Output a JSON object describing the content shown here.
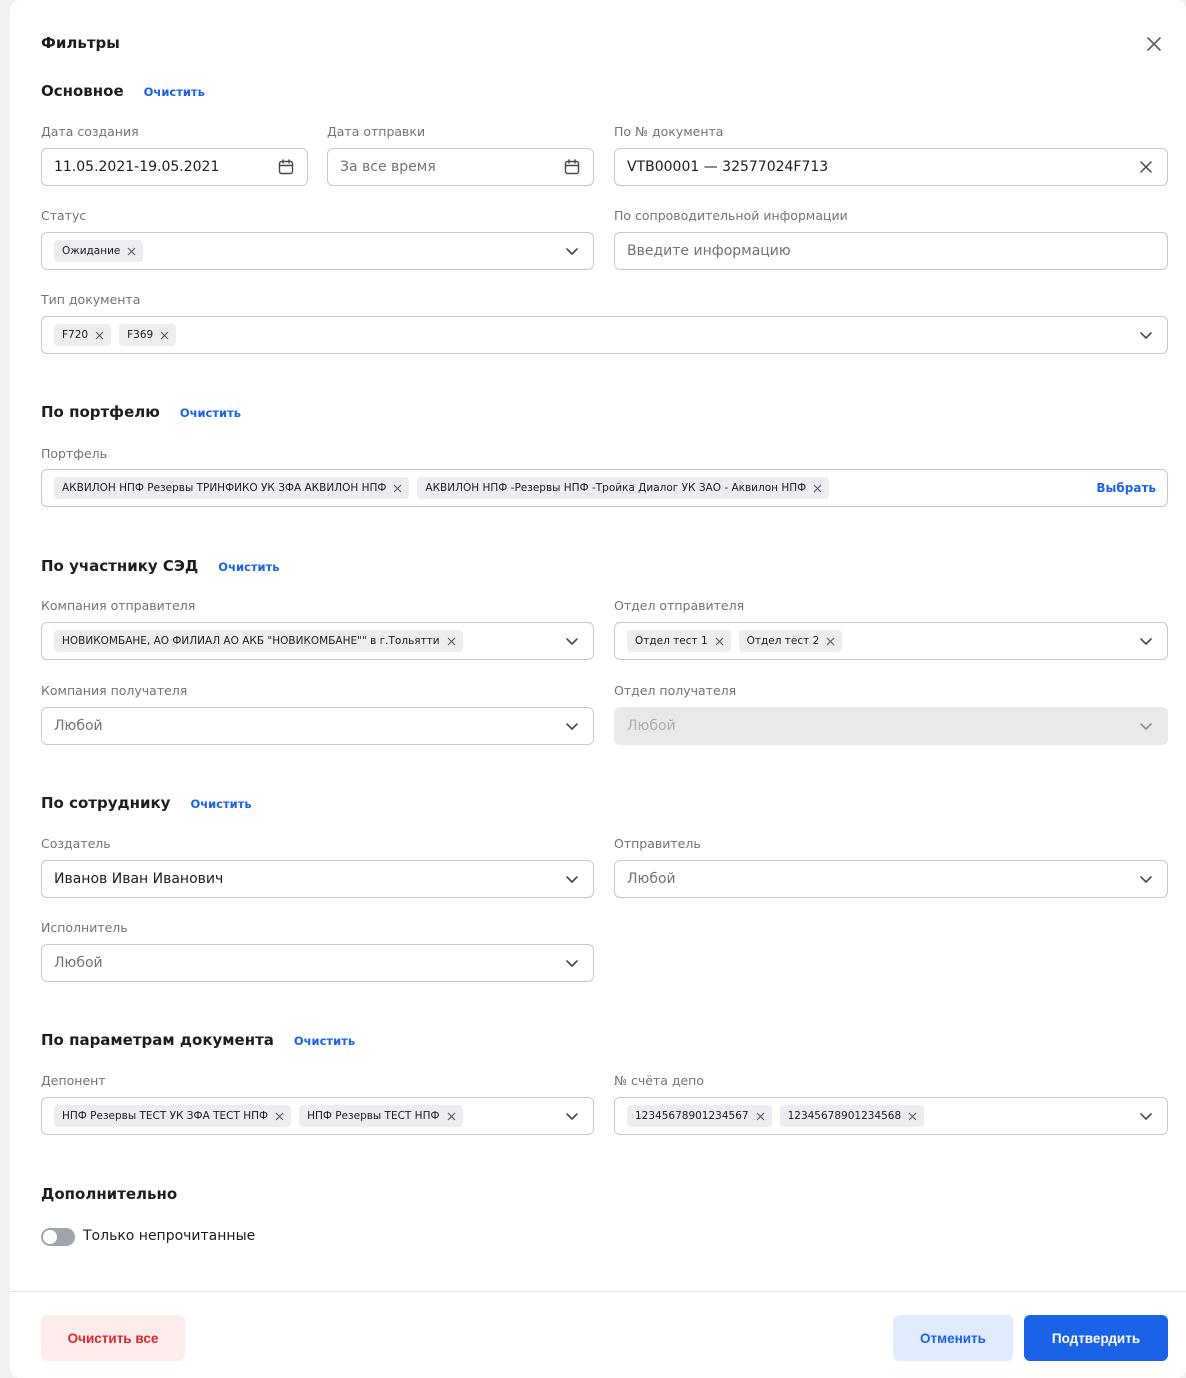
{
  "title": "Фильтры",
  "clear_label": "Очистить",
  "main": {
    "title": "Основное",
    "created_label": "Дата создания",
    "created_value": "11.05.2021-19.05.2021",
    "sent_label": "Дата отправки",
    "sent_placeholder": "За все время",
    "docnum_label": "По № документа",
    "docnum_value": "VTB00001 — 32577024F713",
    "status_label": "Статус",
    "status_chips": [
      "Ожидание"
    ],
    "info_label": "По сопроводительной информации",
    "info_placeholder": "Введите информацию",
    "doctype_label": "Тип документа",
    "doctype_chips": [
      "F720",
      "F369"
    ]
  },
  "portfolio": {
    "title": "По портфелю",
    "label": "Портфель",
    "chips": [
      "АКВИЛОН НПФ Резервы ТРИНФИКО УК ЗФА АКВИЛОН НПФ",
      "АКВИЛОН НПФ -Резервы НПФ -Тройка Диалог УК ЗАО - Аквилон НПФ"
    ],
    "select_label": "Выбрать"
  },
  "sed": {
    "title": "По участнику СЭД",
    "sender_company_label": "Компания отправителя",
    "sender_company_chips": [
      "НОВИКОМБАНЕ, АО ФИЛИАЛ АО АКБ \"НОВИКОМБАНЕ\"\" в г.Тольятти"
    ],
    "sender_dept_label": "Отдел отправителя",
    "sender_dept_chips": [
      "Отдел тест 1",
      "Отдел тест 2"
    ],
    "recipient_company_label": "Компания получателя",
    "recipient_company_placeholder": "Любой",
    "recipient_dept_label": "Отдел получателя",
    "recipient_dept_placeholder": "Любой"
  },
  "employee": {
    "title": "По сотруднику",
    "creator_label": "Создатель",
    "creator_value": "Иванов Иван Иванович",
    "sender_label": "Отправитель",
    "sender_placeholder": "Любой",
    "executor_label": "Исполнитель",
    "executor_placeholder": "Любой"
  },
  "docparams": {
    "title": "По параметрам документа",
    "deponent_label": "Депонент",
    "deponent_chips": [
      "НПФ Резервы ТЕСТ УК ЗФА ТЕСТ НПФ",
      "НПФ Резервы ТЕСТ НПФ"
    ],
    "depo_label": "№ счёта депо",
    "depo_chips": [
      "12345678901234567",
      "12345678901234568"
    ]
  },
  "extra": {
    "title": "Дополнительно",
    "unread_label": "Только непрочитанные",
    "unread_on": false
  },
  "footer": {
    "clear_all": "Очистить все",
    "cancel": "Отменить",
    "confirm": "Подтвердить"
  },
  "colors": {
    "accent": "#1a62e8",
    "danger": "#e0252b"
  }
}
